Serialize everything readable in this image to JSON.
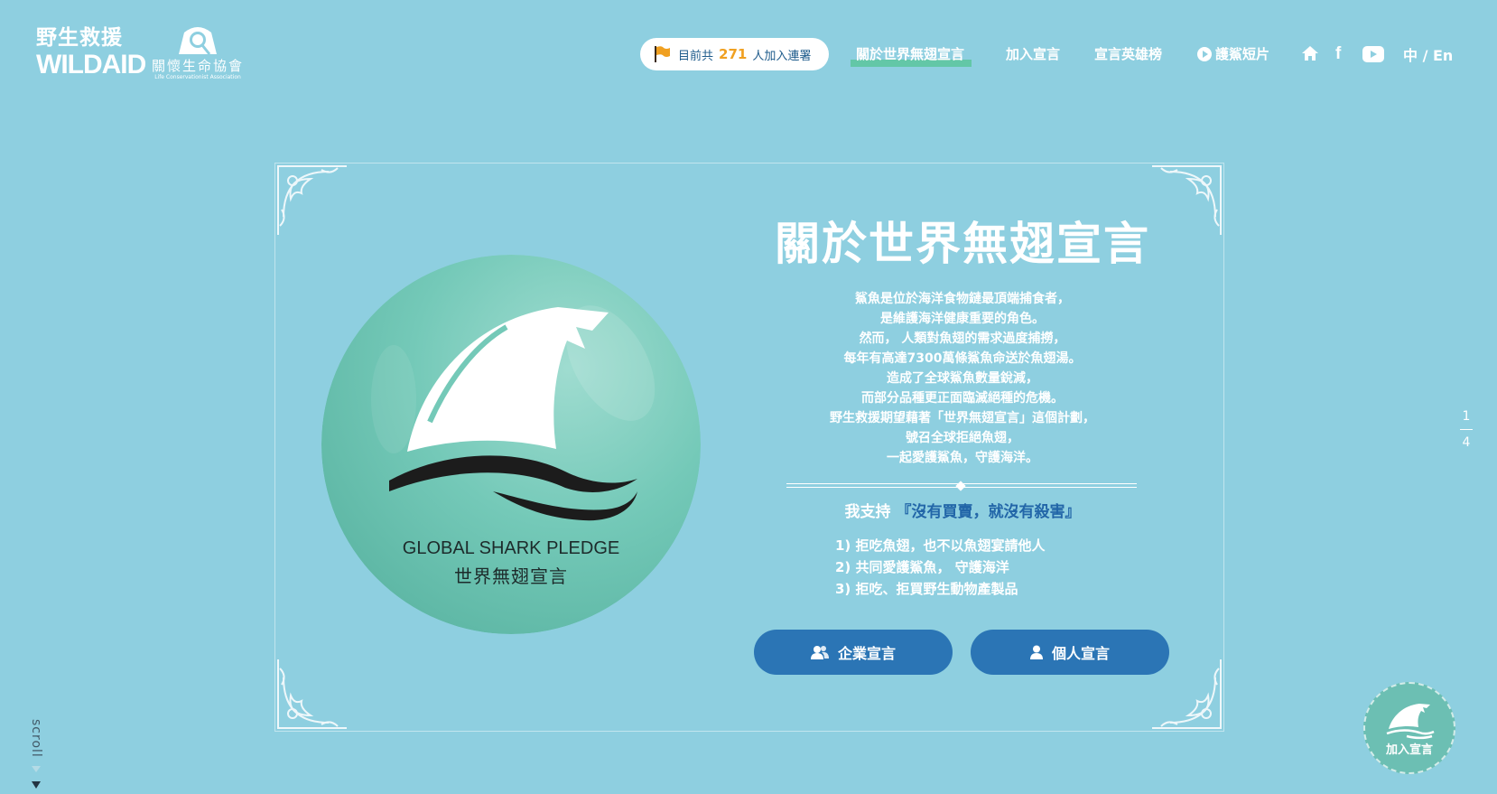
{
  "brand": {
    "wildaid_cn": "野生救援",
    "wildaid_en": "WILDAID",
    "lca_cn": "關懷生命協會",
    "lca_en": "Life Conservationist Association"
  },
  "signers": {
    "prefix": "目前共",
    "count": "271",
    "suffix": "人加入連署"
  },
  "nav": {
    "about": "關於世界無翅宣言",
    "join": "加入宣言",
    "heroes": "宣言英雄榜",
    "video": "護鯊短片",
    "facebook": "f",
    "lang": "中 / En"
  },
  "badge": {
    "en": "GLOBAL SHARK PLEDGE",
    "cn": "世界無翅宣言"
  },
  "main": {
    "title": "關於世界無翅宣言",
    "lines": [
      "鯊魚是位於海洋食物鏈最頂端捕食者，",
      "是維護海洋健康重要的角色。",
      "然而， 人類對魚翅的需求過度捕撈，",
      "每年有高達7300萬條鯊魚命送於魚翅湯。",
      "造成了全球鯊魚數量銳減，",
      "而部分品種更正面臨滅絕種的危機。",
      "野生救援期望藉著「世界無翅宣言」這個計劃，",
      "號召全球拒絕魚翅，",
      "一起愛護鯊魚，守護海洋。"
    ],
    "support_prefix": "我支持",
    "slogan": "『沒有買賣，就沒有殺害』",
    "points": [
      "1) 拒吃魚翅，也不以魚翅宴請他人",
      "2) 共同愛護鯊魚， 守護海洋",
      "3) 拒吃、拒買野生動物產製品"
    ],
    "btn_corporate": "企業宣言",
    "btn_personal": "個人宣言"
  },
  "pager": {
    "current": "1",
    "total": "4"
  },
  "scroll": "scroll",
  "fab_label": "加入宣言",
  "colors": {
    "background": "#8ecfe0",
    "button": "#2b75b5",
    "badge": "#74c9b8",
    "accent_count": "#f0a021",
    "nav_underline": "#63c7a7"
  }
}
